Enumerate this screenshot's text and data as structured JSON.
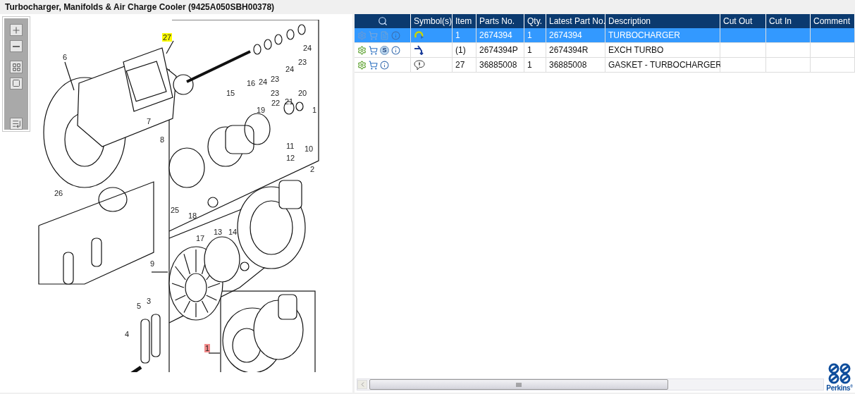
{
  "window": {
    "title": "Turbocharger, Manifolds & Air Charge Cooler (9425A050SBH00378)"
  },
  "callouts": [
    {
      "label": "27",
      "kind": "highlighted"
    },
    {
      "label": "24",
      "kind": "plain"
    },
    {
      "label": "6",
      "kind": "plain"
    },
    {
      "label": "23",
      "kind": "plain"
    },
    {
      "label": "24",
      "kind": "plain"
    },
    {
      "label": "16",
      "kind": "plain"
    },
    {
      "label": "24",
      "kind": "plain"
    },
    {
      "label": "23",
      "kind": "plain"
    },
    {
      "label": "15",
      "kind": "plain"
    },
    {
      "label": "23",
      "kind": "plain"
    },
    {
      "label": "20",
      "kind": "plain"
    },
    {
      "label": "22",
      "kind": "plain"
    },
    {
      "label": "21",
      "kind": "plain"
    },
    {
      "label": "19",
      "kind": "plain"
    },
    {
      "label": "1",
      "kind": "plain"
    },
    {
      "label": "7",
      "kind": "plain"
    },
    {
      "label": "8",
      "kind": "plain"
    },
    {
      "label": "11",
      "kind": "plain"
    },
    {
      "label": "10",
      "kind": "plain"
    },
    {
      "label": "12",
      "kind": "plain"
    },
    {
      "label": "2",
      "kind": "plain"
    },
    {
      "label": "26",
      "kind": "plain"
    },
    {
      "label": "25",
      "kind": "plain"
    },
    {
      "label": "18",
      "kind": "plain"
    },
    {
      "label": "13",
      "kind": "plain"
    },
    {
      "label": "14",
      "kind": "plain"
    },
    {
      "label": "17",
      "kind": "plain"
    },
    {
      "label": "9",
      "kind": "plain"
    },
    {
      "label": "3",
      "kind": "plain"
    },
    {
      "label": "5",
      "kind": "plain"
    },
    {
      "label": "4",
      "kind": "plain"
    },
    {
      "label": "1",
      "kind": "selected"
    }
  ],
  "table": {
    "columns": [
      {
        "kind": "icon"
      },
      {
        "kind": "text",
        "label": "Symbol(s)"
      },
      {
        "kind": "text",
        "label": "Item"
      },
      {
        "kind": "text",
        "label": "Parts No."
      },
      {
        "kind": "text",
        "label": "Qty."
      },
      {
        "kind": "text",
        "label": "Latest Part No."
      },
      {
        "kind": "text",
        "label": "Description"
      },
      {
        "kind": "text",
        "label": "Cut Out"
      },
      {
        "kind": "text",
        "label": "Cut In"
      },
      {
        "kind": "text",
        "label": "Comment"
      }
    ],
    "rows": [
      {
        "selected": true,
        "icons": [
          {
            "kind": "gears"
          },
          {
            "kind": "cart"
          },
          {
            "kind": "document"
          },
          {
            "kind": "info"
          }
        ],
        "symbol": {
          "kind": "rework"
        },
        "item": "1",
        "parts_no": "2674394",
        "qty": "1",
        "latest_part_no": "2674394",
        "description": "TURBOCHARGER"
      },
      {
        "selected": false,
        "icons": [
          {
            "kind": "gear"
          },
          {
            "kind": "cart"
          },
          {
            "kind": "letter",
            "text": "S"
          },
          {
            "kind": "info"
          }
        ],
        "symbol": {
          "kind": "exchange"
        },
        "item": "(1)",
        "parts_no": "2674394P",
        "qty": "1",
        "latest_part_no": "2674394R",
        "description": "EXCH TURBO"
      },
      {
        "selected": false,
        "icons": [
          {
            "kind": "gear"
          },
          {
            "kind": "cart"
          },
          {
            "kind": "info"
          }
        ],
        "symbol": {
          "kind": "note"
        },
        "item": "27",
        "parts_no": "36885008",
        "qty": "1",
        "latest_part_no": "36885008",
        "description": "GASKET - TURBOCHARGER"
      }
    ]
  },
  "logo": {
    "text": "Perkins",
    "mark": "®"
  }
}
